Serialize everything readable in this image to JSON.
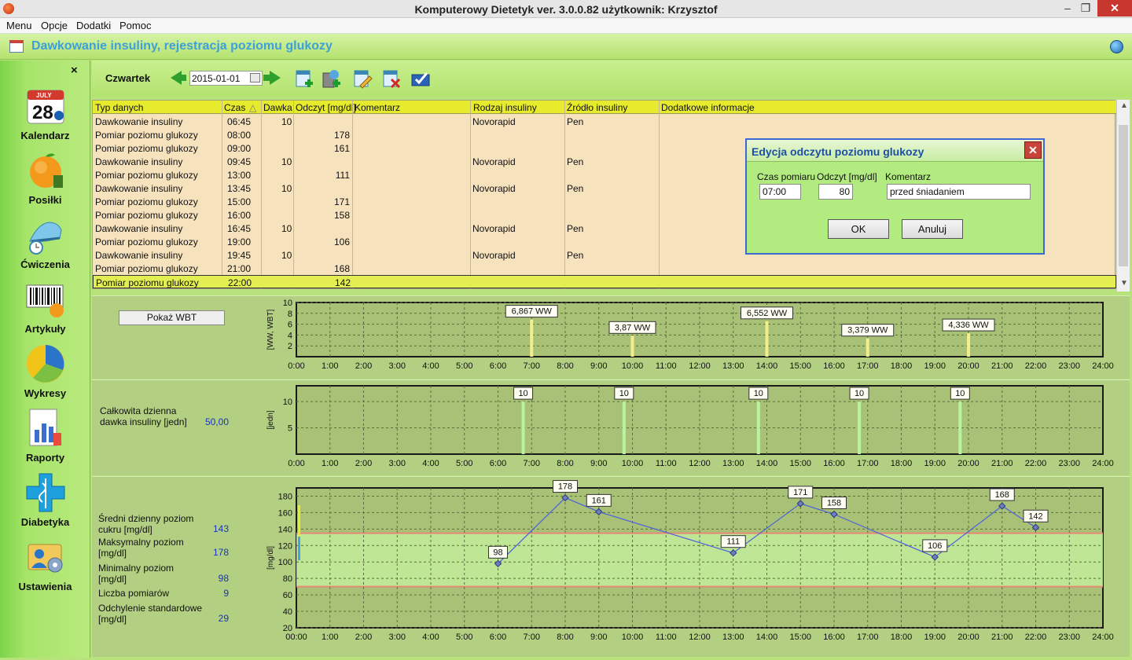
{
  "window": {
    "title": "Komputerowy Dietetyk  ver. 3.0.0.82 użytkownik: Krzysztof",
    "min": "–",
    "max": "❐",
    "close": "✕"
  },
  "menu": [
    "Menu",
    "Opcje",
    "Dodatki",
    "Pomoc"
  ],
  "header": {
    "title": "Dawkowanie insuliny, rejestracja poziomu glukozy"
  },
  "sidebar": {
    "close": "×",
    "items": [
      {
        "label": "Kalendarz",
        "icon": "calendar-icon"
      },
      {
        "label": "Posiłki",
        "icon": "orange-icon"
      },
      {
        "label": "Ćwiczenia",
        "icon": "shoe-icon"
      },
      {
        "label": "Artykuły",
        "icon": "barcode-icon"
      },
      {
        "label": "Wykresy",
        "icon": "pie-chart-icon"
      },
      {
        "label": "Raporty",
        "icon": "report-icon"
      },
      {
        "label": "Diabetyka",
        "icon": "medical-icon"
      },
      {
        "label": "Ustawienia",
        "icon": "settings-icon"
      }
    ],
    "calendar_month": "JULY",
    "calendar_day": "28"
  },
  "toolbar": {
    "day": "Czwartek",
    "date": "2015-01-01"
  },
  "table": {
    "columns": [
      "Typ danych",
      "Czas",
      "Dawka",
      "Odczyt [mg/dl]",
      "Komentarz",
      "Rodzaj insuliny",
      "Źródło insuliny",
      "Dodatkowe informacje"
    ],
    "sort_indicator": "△",
    "rows": [
      {
        "typ": "Dawkowanie insuliny",
        "czas": "06:45",
        "dawka": "10",
        "odczyt": "",
        "rodzaj": "Novorapid",
        "zrodlo": "Pen"
      },
      {
        "typ": "Pomiar poziomu glukozy",
        "czas": "08:00",
        "dawka": "",
        "odczyt": "178",
        "rodzaj": "",
        "zrodlo": ""
      },
      {
        "typ": "Pomiar poziomu glukozy",
        "czas": "09:00",
        "dawka": "",
        "odczyt": "161",
        "rodzaj": "",
        "zrodlo": ""
      },
      {
        "typ": "Dawkowanie insuliny",
        "czas": "09:45",
        "dawka": "10",
        "odczyt": "",
        "rodzaj": "Novorapid",
        "zrodlo": "Pen"
      },
      {
        "typ": "Pomiar poziomu glukozy",
        "czas": "13:00",
        "dawka": "",
        "odczyt": "111",
        "rodzaj": "",
        "zrodlo": ""
      },
      {
        "typ": "Dawkowanie insuliny",
        "czas": "13:45",
        "dawka": "10",
        "odczyt": "",
        "rodzaj": "Novorapid",
        "zrodlo": "Pen"
      },
      {
        "typ": "Pomiar poziomu glukozy",
        "czas": "15:00",
        "dawka": "",
        "odczyt": "171",
        "rodzaj": "",
        "zrodlo": ""
      },
      {
        "typ": "Pomiar poziomu glukozy",
        "czas": "16:00",
        "dawka": "",
        "odczyt": "158",
        "rodzaj": "",
        "zrodlo": ""
      },
      {
        "typ": "Dawkowanie insuliny",
        "czas": "16:45",
        "dawka": "10",
        "odczyt": "",
        "rodzaj": "Novorapid",
        "zrodlo": "Pen"
      },
      {
        "typ": "Pomiar poziomu glukozy",
        "czas": "19:00",
        "dawka": "",
        "odczyt": "106",
        "rodzaj": "",
        "zrodlo": ""
      },
      {
        "typ": "Dawkowanie insuliny",
        "czas": "19:45",
        "dawka": "10",
        "odczyt": "",
        "rodzaj": "Novorapid",
        "zrodlo": "Pen"
      },
      {
        "typ": "Pomiar poziomu glukozy",
        "czas": "21:00",
        "dawka": "",
        "odczyt": "168",
        "rodzaj": "",
        "zrodlo": ""
      },
      {
        "typ": "Pomiar poziomu glukozy",
        "czas": "22:00",
        "dawka": "",
        "odczyt": "142",
        "rodzaj": "",
        "zrodlo": ""
      }
    ],
    "selected_row": 12
  },
  "wbt": {
    "button": "Pokaż WBT"
  },
  "insulin_panel": {
    "label_line1": "Całkowita dzienna",
    "label_line2": "dawka insuliny [jedn]",
    "value": "50,00"
  },
  "glucose_stats": [
    {
      "label": "Średni dzienny poziom cukru [mg/dl]",
      "value": "143"
    },
    {
      "label": "Maksymalny poziom [mg/dl]",
      "value": "178"
    },
    {
      "label": "Minimalny poziom [mg/dl]",
      "value": "98"
    },
    {
      "label": "Liczba pomiarów",
      "value": "9"
    },
    {
      "label": "Odchylenie standardowe [mg/dl]",
      "value": "29"
    }
  ],
  "dialog": {
    "title": "Edycja odczytu poziomu glukozy",
    "close": "✕",
    "labels": [
      "Czas pomiaru",
      "Odczyt [mg/dl]",
      "Komentarz"
    ],
    "czas": "07:00",
    "odczyt": "80",
    "komentarz": "przed śniadaniem",
    "ok": "OK",
    "cancel": "Anuluj"
  },
  "colors": {
    "accent_green": "#b7e27c",
    "header_yellow": "#e6eb2e",
    "grid_bg": "#f6e2bd",
    "dialog_border": "#3f68d3",
    "line": "#4a5fe0",
    "limit": "#e07a6a"
  },
  "chart_data": [
    {
      "type": "bar",
      "ylabel": "[WW, WBT]",
      "xlim": [
        "0:00",
        "24:00"
      ],
      "ylim": [
        0,
        10
      ],
      "yticks": [
        2,
        4,
        6,
        8,
        10
      ],
      "grid": true,
      "x_ticks": [
        "0:00",
        "1:00",
        "2:00",
        "3:00",
        "4:00",
        "5:00",
        "6:00",
        "7:00",
        "8:00",
        "9:00",
        "10:00",
        "11:00",
        "12:00",
        "13:00",
        "14:00",
        "15:00",
        "16:00",
        "17:00",
        "18:00",
        "19:00",
        "20:00",
        "21:00",
        "22:00",
        "23:00",
        "24:00"
      ],
      "points": [
        {
          "x": "7:00",
          "y": 6.867,
          "label": "6,867 WW"
        },
        {
          "x": "10:00",
          "y": 3.87,
          "label": "3,87 WW"
        },
        {
          "x": "14:00",
          "y": 6.552,
          "label": "6,552 WW"
        },
        {
          "x": "17:00",
          "y": 3.379,
          "label": "3,379 WW"
        },
        {
          "x": "20:00",
          "y": 4.336,
          "label": "4,336 WW"
        }
      ]
    },
    {
      "type": "bar",
      "ylabel": "[jedn]",
      "xlim": [
        "0:00",
        "24:00"
      ],
      "ylim": [
        0,
        13
      ],
      "yticks": [
        5,
        10
      ],
      "grid": true,
      "x_ticks": [
        "0:00",
        "1:00",
        "2:00",
        "3:00",
        "4:00",
        "5:00",
        "6:00",
        "7:00",
        "8:00",
        "9:00",
        "10:00",
        "11:00",
        "12:00",
        "13:00",
        "14:00",
        "15:00",
        "16:00",
        "17:00",
        "18:00",
        "19:00",
        "20:00",
        "21:00",
        "22:00",
        "23:00",
        "24:00"
      ],
      "points": [
        {
          "x": "6:45",
          "y": 10,
          "label": "10"
        },
        {
          "x": "9:45",
          "y": 10,
          "label": "10"
        },
        {
          "x": "13:45",
          "y": 10,
          "label": "10"
        },
        {
          "x": "16:45",
          "y": 10,
          "label": "10"
        },
        {
          "x": "19:45",
          "y": 10,
          "label": "10"
        }
      ]
    },
    {
      "type": "line",
      "ylabel": "[mg/dl]",
      "xlim": [
        "00:00",
        "24:00"
      ],
      "ylim": [
        20,
        190
      ],
      "yticks": [
        20,
        40,
        60,
        80,
        100,
        120,
        140,
        160,
        180
      ],
      "grid": true,
      "range": [
        70,
        135
      ],
      "x_ticks": [
        "00:00",
        "1:00",
        "2:00",
        "3:00",
        "4:00",
        "5:00",
        "6:00",
        "7:00",
        "8:00",
        "9:00",
        "10:00",
        "11:00",
        "12:00",
        "13:00",
        "14:00",
        "15:00",
        "16:00",
        "17:00",
        "18:00",
        "19:00",
        "20:00",
        "21:00",
        "22:00",
        "23:00",
        "24:00"
      ],
      "points": [
        {
          "x": "6:00",
          "y": 98
        },
        {
          "x": "8:00",
          "y": 178
        },
        {
          "x": "9:00",
          "y": 161
        },
        {
          "x": "13:00",
          "y": 111
        },
        {
          "x": "15:00",
          "y": 171
        },
        {
          "x": "16:00",
          "y": 158
        },
        {
          "x": "19:00",
          "y": 106
        },
        {
          "x": "21:00",
          "y": 168
        },
        {
          "x": "22:00",
          "y": 142
        }
      ]
    }
  ]
}
